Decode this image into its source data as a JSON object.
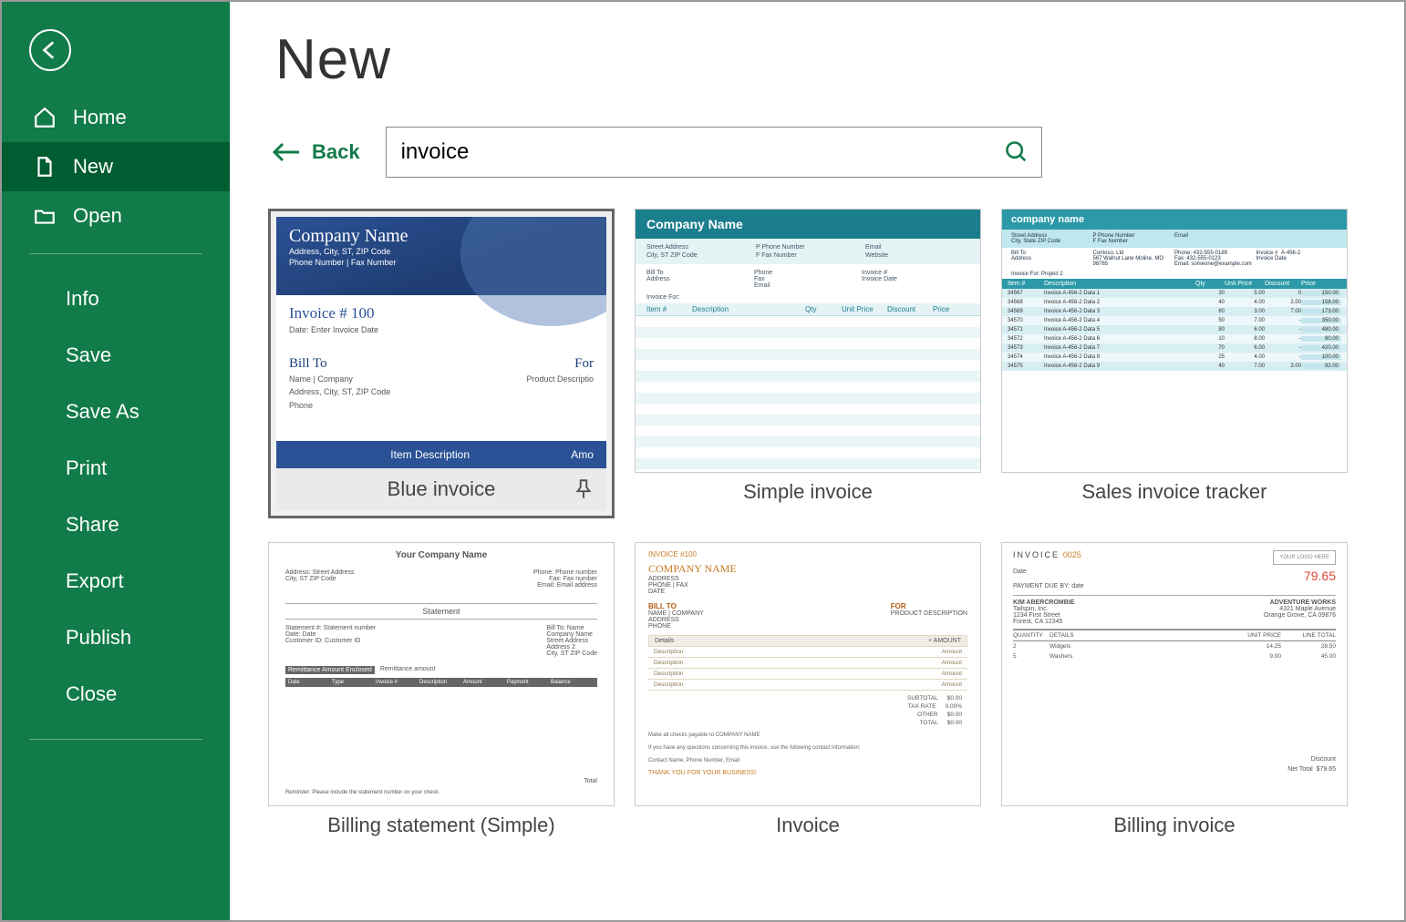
{
  "sidebar": {
    "items": [
      {
        "id": "home",
        "label": "Home"
      },
      {
        "id": "new",
        "label": "New"
      },
      {
        "id": "open",
        "label": "Open"
      }
    ],
    "sub_items": [
      {
        "id": "info",
        "label": "Info"
      },
      {
        "id": "save",
        "label": "Save"
      },
      {
        "id": "saveas",
        "label": "Save As"
      },
      {
        "id": "print",
        "label": "Print"
      },
      {
        "id": "share",
        "label": "Share"
      },
      {
        "id": "export",
        "label": "Export"
      },
      {
        "id": "publish",
        "label": "Publish"
      },
      {
        "id": "close",
        "label": "Close"
      }
    ]
  },
  "page": {
    "title": "New",
    "back_label": "Back",
    "search_value": "invoice"
  },
  "templates": [
    {
      "name": "Blue invoice",
      "selected": true
    },
    {
      "name": "Simple invoice",
      "selected": false
    },
    {
      "name": "Sales invoice tracker",
      "selected": false
    },
    {
      "name": "Billing statement (Simple)",
      "selected": false
    },
    {
      "name": "Invoice",
      "selected": false
    },
    {
      "name": "Billing invoice",
      "selected": false
    }
  ],
  "thumb": {
    "blue": {
      "company": "Company Name",
      "addr1": "Address, City, ST, ZIP Code",
      "addr2": "Phone Number | Fax Number",
      "invoice_no": "Invoice # 100",
      "date_lbl": "Date: Enter Invoice Date",
      "bill_to": "Bill To",
      "for": "For",
      "bt1": "Name | Company",
      "bt2": "Address, City, ST, ZIP Code",
      "bt3": "Phone",
      "for1": "Product Descriptio",
      "col1": "Item Description",
      "col2": "Amo"
    },
    "simple": {
      "company": "Company Name",
      "sa": "Street Address",
      "pn": "P   Phone Number",
      "em": "Email",
      "cz": "City, ST ZIP Code",
      "fx": "F   Fax Number",
      "ws": "Website",
      "billto": "Bill To",
      "phone": "Phone",
      "invno": "Invoice #",
      "addr": "Address",
      "fax": "Fax",
      "invdate": "Invoice Date",
      "email": "Email",
      "invfor": "Invoice For:",
      "c1": "Item #",
      "c2": "Description",
      "c3": "Qty",
      "c4": "Unit Price",
      "c5": "Discount",
      "c6": "Price"
    },
    "tracker": {
      "company": "company name",
      "h1": "Street Address",
      "h2": "P Phone Number",
      "h3": "Email",
      "h4": "City, State ZIP Code",
      "h5": "F Fax Number",
      "billto": "Bill To",
      "contoso": "Contoso, Ltd",
      "ph": "Phone: 432-555-0189",
      "invno": "Invoice #",
      "invno_v": "A-456-2",
      "addr": "Address",
      "addr_v": "567 Walnut Lane\nMoline, MO 98765",
      "fx": "Fax:    432-555-0123",
      "eml": "Email: someone@example.com",
      "invd": "Invoice Date",
      "invfor": "Invoice For: Project 2",
      "c1": "Item #",
      "c2": "Description",
      "c3": "Qty",
      "c4": "Unit Price",
      "c5": "Discount",
      "c6": "Price",
      "rows": [
        [
          "34567",
          "Invoice A-456-2 Data 1",
          "30",
          "5.00",
          "0",
          "150.00"
        ],
        [
          "34568",
          "Invoice A-456-2 Data 2",
          "40",
          "4.00",
          "2.00",
          "158.00"
        ],
        [
          "34569",
          "Invoice A-456-2 Data 3",
          "60",
          "3.00",
          "7.00",
          "173.00"
        ],
        [
          "34570",
          "Invoice A-456-2 Data 4",
          "50",
          "7.00",
          "-",
          "350.00"
        ],
        [
          "34571",
          "Invoice A-456-2 Data 5",
          "80",
          "6.00",
          "-",
          "480.00"
        ],
        [
          "34572",
          "Invoice A-456-2 Data 6",
          "10",
          "8.00",
          "-",
          "80.00"
        ],
        [
          "34573",
          "Invoice A-456-2 Data 7",
          "70",
          "6.00",
          "-",
          "420.00"
        ],
        [
          "34574",
          "Invoice A-456-2 Data 8",
          "25",
          "4.00",
          "-",
          "100.00"
        ],
        [
          "34575",
          "Invoice A-456-2 Data 9",
          "40",
          "7.00",
          "3.00",
          "92.00"
        ]
      ]
    },
    "bss": {
      "company": "Your Company Name",
      "a1": "Address:  Street Address",
      "p1": "Phone:  Phone number",
      "a2": "City, ST ZIP Code",
      "p2": "Fax:  Fax number",
      "p3": "Email:  Email address",
      "stmt": "Statement",
      "s1": "Statement #:  Statement number",
      "b1": "Bill To:  Name",
      "s2": "Date:  Date",
      "b2": "Company Name",
      "s3": "Customer ID:  Customer ID",
      "b3": "Street Address",
      "b4": "Address 2",
      "b5": "City, ST ZIP Code",
      "bar_lbl": "Remittance Amount Enclosed",
      "bar_amt": "Remittance amount",
      "cols": [
        "Date",
        "Type",
        "Invoice #",
        "Description",
        "Amount",
        "Payment",
        "Balance"
      ],
      "total": "Total",
      "reminder": "Reminder: Please include the statement number on your check."
    },
    "invo": {
      "num": "INVOICE #100",
      "company": "COMPANY NAME",
      "addr": "ADDRESS",
      "phone": "PHONE | FAX",
      "date": "DATE",
      "billto": "BILL TO",
      "for": "FOR",
      "bt1": "NAME | COMPANY",
      "for1": "PRODUCT DESCRIPTION",
      "bt2": "ADDRESS",
      "bt3": "PHONE",
      "details": "Details",
      "amount": "+  AMOUNT",
      "desc": "Description",
      "amt": "Amount",
      "totals": [
        [
          "SUBTOTAL",
          "$0.00"
        ],
        [
          "TAX RATE",
          "0.00%"
        ],
        [
          "OTHER",
          "$0.00"
        ],
        [
          "TOTAL",
          "$0.00"
        ]
      ],
      "note1": "Make all checks payable to COMPANY NAME",
      "note2": "If you have any questions concerning this invoice, use the following contact information:",
      "note3": "Contact Name, Phone Number, Email",
      "foot": "THANK YOU FOR YOUR BUSINESS!"
    },
    "bi": {
      "inv": "INVOICE",
      "num": "0025",
      "logo": "YOUR LOGO HERE",
      "date": "Date",
      "pay": "PAYMENT DUE BY:",
      "payv": "date",
      "amt": "79.65",
      "n1": "KIM ABERCROMBIE",
      "n2": "Tailspin, Inc.",
      "n3": "1234 First Street",
      "n4": "Forest, CA 12345",
      "m1": "ADVENTURE WORKS",
      "m2": "4321 Maple Avenue",
      "m3": "Orange Grove, CA 09876",
      "c1": "QUANTITY",
      "c2": "DETAILS",
      "c3": "UNIT PRICE",
      "c4": "LINE TOTAL",
      "rows": [
        [
          "2",
          "Widgets",
          "14.25",
          "28.50"
        ],
        [
          "5",
          "Washers",
          "9.00",
          "45.00"
        ]
      ],
      "disc": "Discount",
      "nettot": "Net Total",
      "tot": "$79.65"
    }
  }
}
